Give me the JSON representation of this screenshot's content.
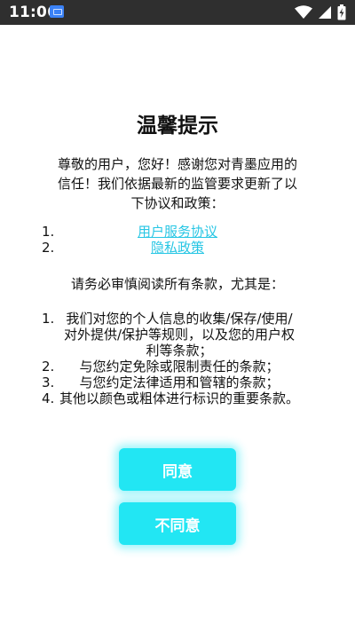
{
  "status_bar": {
    "time": "11:06",
    "icons": [
      "notification-icon",
      "wifi-icon",
      "signal-icon",
      "battery-charging-icon"
    ]
  },
  "dialog": {
    "title": "温馨提示",
    "intro": "尊敬的用户，您好！感谢您对青墨应用的信任！我们依据最新的监管要求更新了以下协议和政策：",
    "links": [
      {
        "num": "1.",
        "label": "用户服务协议"
      },
      {
        "num": "2.",
        "label": "隐私政策"
      }
    ],
    "notice": "请务必审慎阅读所有条款，尤其是：",
    "terms": [
      {
        "num": "1.",
        "text": "我们对您的个人信息的收集/保存/使用/对外提供/保护等规则，以及您的用户权利等条款；"
      },
      {
        "num": "2.",
        "text": "与您约定免除或限制责任的条款；"
      },
      {
        "num": "3.",
        "text": "与您约定法律适用和管辖的条款；"
      },
      {
        "num": "4.",
        "text": "其他以颜色或粗体进行标识的重要条款。"
      }
    ],
    "buttons": {
      "agree": "同意",
      "disagree": "不同意"
    }
  },
  "colors": {
    "accent": "#22e6f3",
    "link": "#27c6e4",
    "status_bar": "#2f2f2f"
  }
}
